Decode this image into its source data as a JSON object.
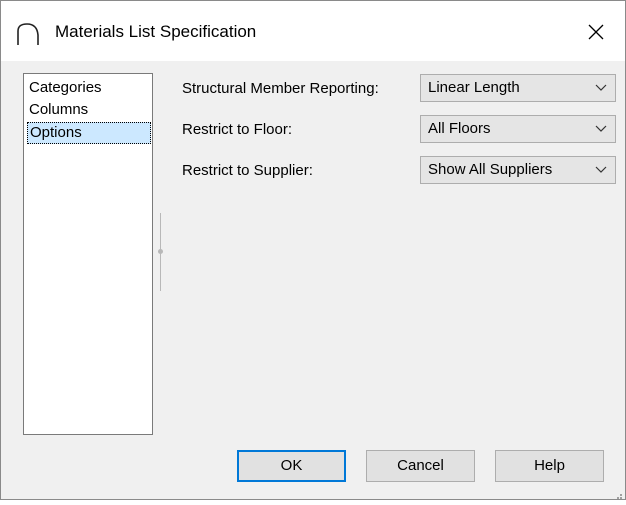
{
  "window": {
    "title": "Materials List Specification",
    "icons": {
      "app": "arch-icon",
      "close": "close-icon"
    }
  },
  "categories": {
    "items": [
      {
        "label": "Categories",
        "selected": false
      },
      {
        "label": "Columns",
        "selected": false
      },
      {
        "label": "Options",
        "selected": true
      }
    ]
  },
  "options": {
    "structural_member_reporting": {
      "label": "Structural Member Reporting:",
      "value": "Linear Length"
    },
    "restrict_to_floor": {
      "label": "Restrict to Floor:",
      "value": "All Floors"
    },
    "restrict_to_supplier": {
      "label": "Restrict to Supplier:",
      "value": "Show All Suppliers"
    }
  },
  "buttons": {
    "ok": "OK",
    "cancel": "Cancel",
    "help": "Help"
  },
  "colors": {
    "selection": "#cce8ff",
    "default_button_border": "#0078d7",
    "dialog_background": "#f0f0f0"
  }
}
